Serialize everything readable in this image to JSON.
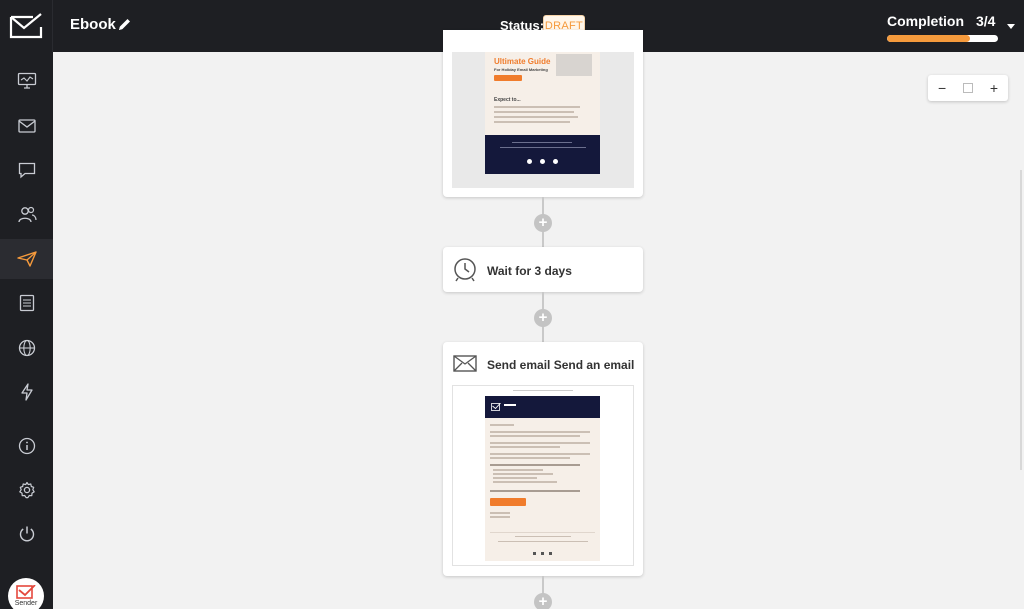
{
  "header": {
    "title": "Ebook",
    "status_label": "Status:",
    "status_value": "DRAFT",
    "completion_label": "Completion",
    "completion_count": "3/4",
    "completion_progress": 0.75
  },
  "sidebar": {
    "items": [
      {
        "name": "dashboard-icon"
      },
      {
        "name": "mail-icon"
      },
      {
        "name": "chat-icon"
      },
      {
        "name": "subscribers-icon"
      },
      {
        "name": "send-icon",
        "active": true
      },
      {
        "name": "forms-icon"
      },
      {
        "name": "globe-icon"
      },
      {
        "name": "automation-icon"
      },
      {
        "name": "info-icon"
      },
      {
        "name": "gear-icon"
      },
      {
        "name": "power-icon"
      }
    ],
    "avatar_label": "Sender"
  },
  "zoom": {
    "minus": "−",
    "plus": "+"
  },
  "flow": {
    "email1_preview": {
      "heading": "Ultimate Guide",
      "subheading": "For Holiday Email Marketing",
      "section_title": "Expect to..."
    },
    "wait_step": {
      "label": "Wait for 3 days"
    },
    "email2_step": {
      "label": "Send email Send an email"
    },
    "plus_symbol": "+"
  },
  "colors": {
    "accent": "#f59a3c",
    "sidebar_bg": "#1e1f23",
    "canvas_bg": "#f2f2f2",
    "email_navy": "#14183b"
  }
}
